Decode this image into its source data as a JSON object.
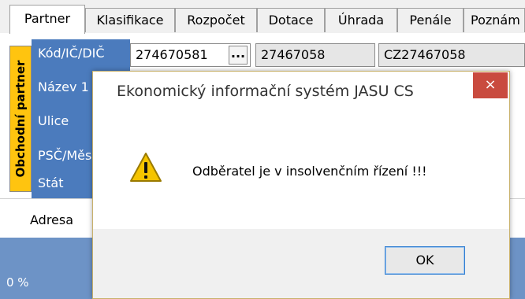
{
  "tabs": [
    {
      "label": "Partner"
    },
    {
      "label": "Klasifikace"
    },
    {
      "label": "Rozpočet"
    },
    {
      "label": "Dotace"
    },
    {
      "label": "Úhrada"
    },
    {
      "label": "Penále"
    },
    {
      "label": "Poznám"
    }
  ],
  "partner_section": {
    "vertical_label": "Obchodní partner",
    "labels": [
      "Kód/IČ/DIČ",
      "Název 1",
      "Ulice",
      "PSČ/Měs",
      "Stát"
    ],
    "kod_value": "274670581",
    "ico_value": "27467058",
    "dic_value": "CZ27467058",
    "ellipsis": "..."
  },
  "subtab": {
    "label": "Adresa"
  },
  "status": {
    "progress": "0 %"
  },
  "dialog": {
    "title": "Ekonomický informační systém JASU CS",
    "close": "×",
    "message": "Odběratel je v insolvenčním řízení !!!",
    "ok": "OK"
  },
  "colors": {
    "label_blue": "#4b7bbd",
    "orange": "#ffc40f",
    "close_red": "#c94b3f",
    "status_blue": "#6d93c6"
  }
}
